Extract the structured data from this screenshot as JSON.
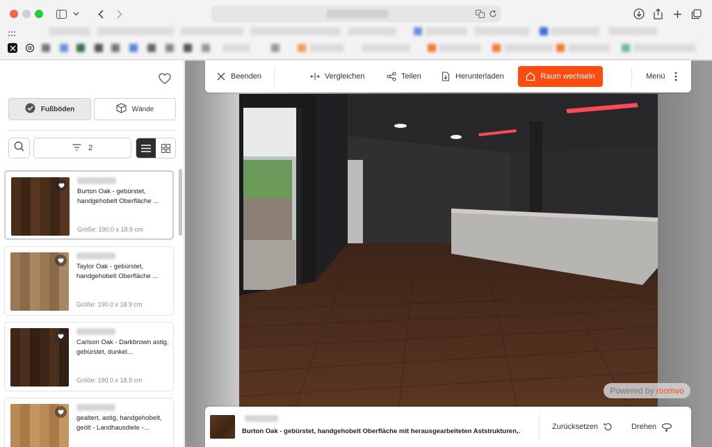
{
  "browser": {
    "icons": [
      "sidebar-icon",
      "chevron-down-icon",
      "back-icon",
      "forward-icon",
      "translate-icon",
      "reload-icon",
      "download-icon",
      "share-icon",
      "new-tab-icon",
      "tabs-overview-icon"
    ],
    "bookmark_icons": [
      "x-icon",
      "openai-icon"
    ]
  },
  "sidebar": {
    "categories": {
      "floors": "Fußböden",
      "walls": "Wände"
    },
    "filter_count": "2",
    "products": [
      {
        "title": "Burton Oak - gebürstet, handgehobelt Oberfläche ...",
        "size": "Größe: 190.0 x 18.9 cm",
        "selected": true,
        "color": "#4a2e1c"
      },
      {
        "title": "Taylor Oak - gebürstet, handgehobelt Oberfläche ...",
        "size": "Größe: 190.0 x 18.9 cm",
        "selected": false,
        "color": "#9a7a55"
      },
      {
        "title": "Carlson Oak - Darkbrown astig, gebürstet, dunkel...",
        "size": "Größe: 190.0 x 18.9 cm",
        "selected": false,
        "color": "#3d2618"
      },
      {
        "title": "gealtert, astig, handgehobelt, geölt - Landhausdiele -...",
        "size": "",
        "selected": false,
        "color": "#b98a55"
      }
    ]
  },
  "toolbar": {
    "close": "Beenden",
    "compare": "Vergleichen",
    "share": "Teilen",
    "download": "Herunterladen",
    "switch_room": "Raum wechseln",
    "menu": "Menü"
  },
  "powered": {
    "prefix": "Powered by",
    "brand": "roomvo"
  },
  "bottom": {
    "title": "Burton Oak - gebürstet, handgehobelt Oberfläche mit herausgearbeiteten Aststrukturen,...",
    "reset": "Zurücksetzen",
    "rotate": "Drehen"
  },
  "colors": {
    "accent": "#fe4b0f",
    "floor": "#4a2e1c"
  }
}
